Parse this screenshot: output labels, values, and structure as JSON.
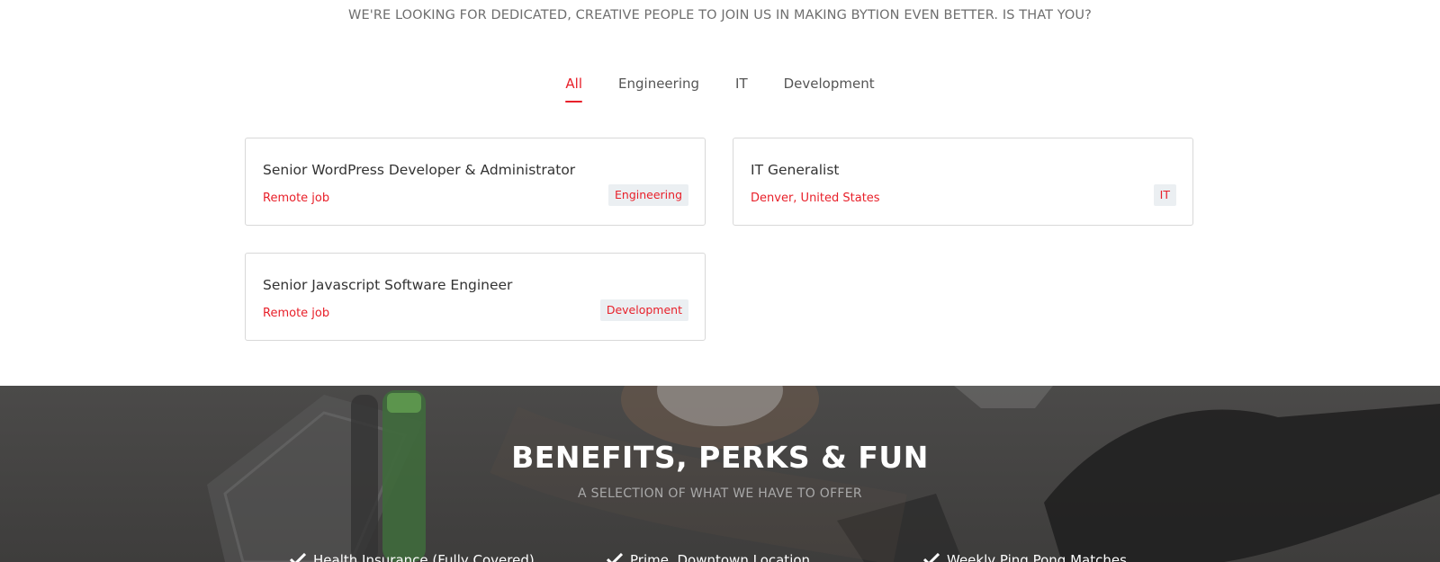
{
  "intro": {
    "subtitle": "WE'RE LOOKING FOR DEDICATED, CREATIVE PEOPLE TO JOIN US IN MAKING BYTION EVEN BETTER. IS THAT YOU?"
  },
  "tabs": [
    {
      "label": "All",
      "active": true
    },
    {
      "label": "Engineering",
      "active": false
    },
    {
      "label": "IT",
      "active": false
    },
    {
      "label": "Development",
      "active": false
    }
  ],
  "jobs": [
    {
      "title": "Senior WordPress Developer & Administrator",
      "location": "Remote job",
      "tag": "Engineering"
    },
    {
      "title": "IT Generalist",
      "location": "Denver, United States",
      "tag": "IT"
    },
    {
      "title": "Senior Javascript Software Engineer",
      "location": "Remote job",
      "tag": "Development"
    }
  ],
  "benefits": {
    "heading": "BENEFITS, PERKS & FUN",
    "subheading": "A SELECTION OF WHAT WE HAVE TO OFFER",
    "items": [
      "Health Insurance (Fully Covered)",
      "Prime, Downtown Location",
      "Weekly Ping Pong Matches"
    ]
  },
  "colors": {
    "accent": "#e8202a",
    "tag_bg": "#ebeff2",
    "dark_band": "#454443"
  },
  "icons": {
    "perk": "check-icon"
  }
}
